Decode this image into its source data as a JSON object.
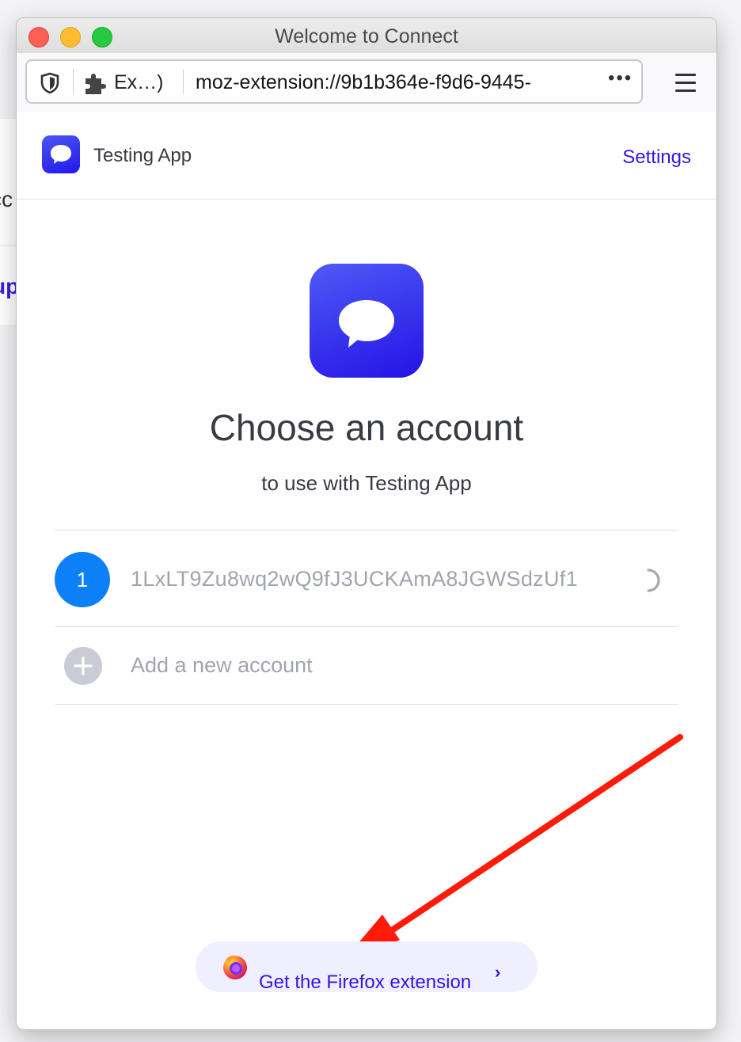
{
  "window": {
    "title": "Welcome to Connect"
  },
  "browser": {
    "extension_label": "Ex…)",
    "url": "moz-extension://9b1b364e-f9d6-9445-",
    "url_more": "•••"
  },
  "header": {
    "app_name": "Testing App",
    "settings_label": "Settings"
  },
  "main": {
    "title": "Choose an account",
    "subtitle": "to use with Testing App",
    "accounts": [
      {
        "index": "1",
        "address": "1LxLT9Zu8wq2wQ9fJ3UCKAmA8JGWSdzUf1"
      }
    ],
    "add_account_label": "Add a new account"
  },
  "footer": {
    "firefox_extension_label": "Get the Firefox extension",
    "chevron": "›"
  },
  "background_page": {
    "text_1": "cc",
    "text_2": "up"
  },
  "colors": {
    "accent": "#3a12dc",
    "avatar": "#0c80f7",
    "logo_gradient_start": "#4f5af6",
    "logo_gradient_end": "#2414e6",
    "annotation_arrow": "#ff1a0a"
  }
}
